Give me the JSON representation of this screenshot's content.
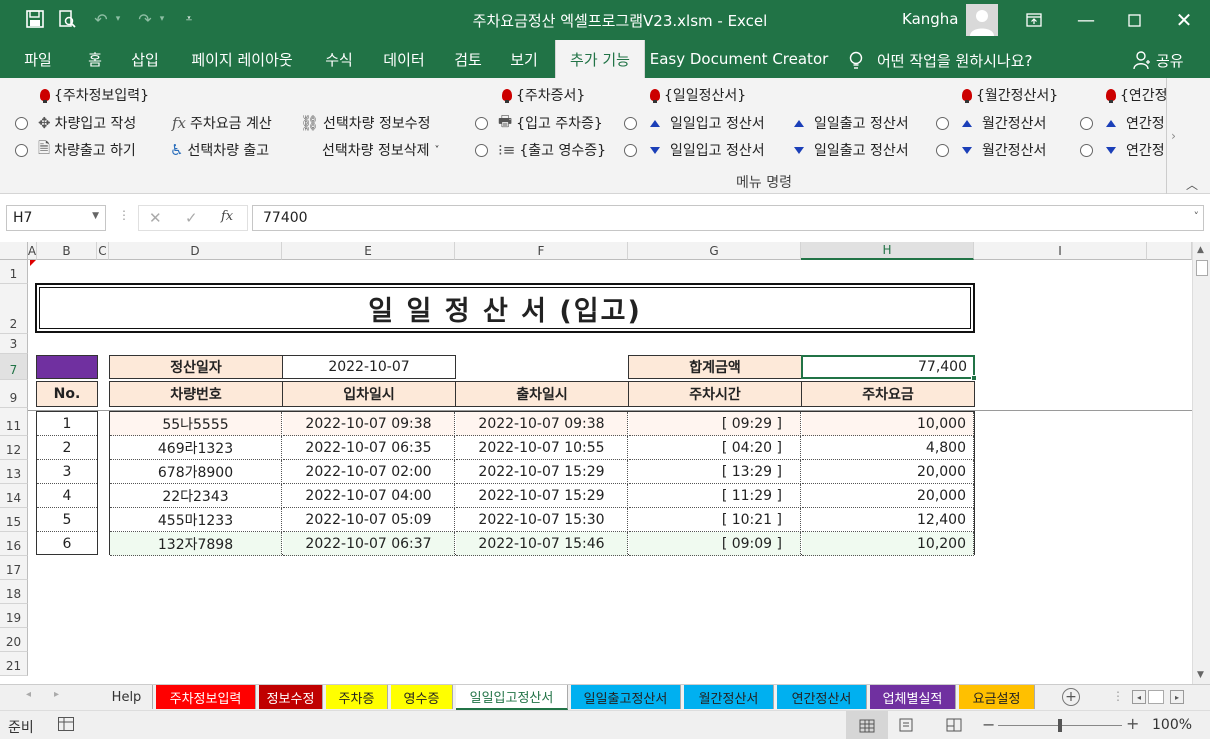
{
  "window": {
    "title": "주차요금정산 엑셀프로그램V23.xlsm  -  Excel",
    "user": "Kangha"
  },
  "ribbon_tabs": [
    "파일",
    "홈",
    "삽입",
    "페이지 레이아웃",
    "수식",
    "데이터",
    "검토",
    "보기",
    "추가 기능",
    "Easy Document Creator"
  ],
  "tell_me": "어떤 작업을 원하시나요?",
  "share": "공유",
  "ribbon": {
    "group1_title": "{주차정보입력}",
    "car_in": "차량입고 작성",
    "car_out": "차량출고 하기",
    "fee_calc": "주차요금 계산",
    "selected_out": "선택차량 출고",
    "selected_edit": "선택차량 정보수정",
    "selected_delete": "선택차량 정보삭제",
    "group2_title": "{주차증서}",
    "in_ticket": "{입고 주차증}",
    "out_receipt": "{출고 영수증}",
    "group3_title": "{일일정산서}",
    "daily_in_1": "일일입고 정산서",
    "daily_in_2": "일일입고 정산서",
    "daily_out_1": "일일출고 정산서",
    "daily_out_2": "일일출고 정산서",
    "group4_title": "{월간정산서}",
    "monthly_1": "월간정산서",
    "monthly_2": "월간정산서",
    "group5_title": "{연간정",
    "yearly_1": "연간정",
    "yearly_2": "연간정",
    "menu_label": "메뉴 명령"
  },
  "formula_bar": {
    "name_box": "H7",
    "value": "77400"
  },
  "columns": [
    "A",
    "B",
    "C",
    "D",
    "E",
    "F",
    "G",
    "H",
    "I"
  ],
  "rows": [
    "1",
    "2",
    "3",
    "7",
    "9",
    "11",
    "12",
    "13",
    "14",
    "15",
    "16",
    "17",
    "18",
    "19",
    "20",
    "21"
  ],
  "sheet": {
    "title": "일 일 정 산 서 (입고)",
    "date_label": "정산일자",
    "date_value": "2022-10-07",
    "total_label": "합계금액",
    "total_value": "77,400",
    "headers": {
      "no": "No.",
      "car": "차량번호",
      "in": "입차일시",
      "out": "출차일시",
      "time": "주차시간",
      "fee": "주차요금"
    },
    "records": [
      {
        "no": "1",
        "car": "55나5555",
        "in": "2022-10-07 09:38",
        "out": "2022-10-07 09:38",
        "time": "[ 09:29 ]",
        "fee": "10,000"
      },
      {
        "no": "2",
        "car": "469라1323",
        "in": "2022-10-07 06:35",
        "out": "2022-10-07 10:55",
        "time": "[ 04:20 ]",
        "fee": "4,800"
      },
      {
        "no": "3",
        "car": "678가8900",
        "in": "2022-10-07 02:00",
        "out": "2022-10-07 15:29",
        "time": "[ 13:29 ]",
        "fee": "20,000"
      },
      {
        "no": "4",
        "car": "22다2343",
        "in": "2022-10-07 04:00",
        "out": "2022-10-07 15:29",
        "time": "[ 11:29 ]",
        "fee": "20,000"
      },
      {
        "no": "5",
        "car": "455마1233",
        "in": "2022-10-07 05:09",
        "out": "2022-10-07 15:30",
        "time": "[ 10:21 ]",
        "fee": "12,400"
      },
      {
        "no": "6",
        "car": "132자7898",
        "in": "2022-10-07 06:37",
        "out": "2022-10-07 15:46",
        "time": "[ 09:09 ]",
        "fee": "10,200"
      }
    ]
  },
  "sheet_tabs": [
    {
      "label": "Help",
      "bg": "#f0f0f0",
      "fg": "#333"
    },
    {
      "label": "주차정보입력",
      "bg": "#ff0000",
      "fg": "#fff"
    },
    {
      "label": "정보수정",
      "bg": "#c00000",
      "fg": "#fff"
    },
    {
      "label": "주차증",
      "bg": "#ffff00",
      "fg": "#222"
    },
    {
      "label": "영수증",
      "bg": "#ffff00",
      "fg": "#222"
    },
    {
      "label": "일일입고정산서",
      "bg": "#ffffff",
      "fg": "#217346"
    },
    {
      "label": "일일출고정산서",
      "bg": "#00b0f0",
      "fg": "#222"
    },
    {
      "label": "월간정산서",
      "bg": "#00b0f0",
      "fg": "#222"
    },
    {
      "label": "연간정산서",
      "bg": "#00b0f0",
      "fg": "#222"
    },
    {
      "label": "업체별실적",
      "bg": "#7030a0",
      "fg": "#fff"
    },
    {
      "label": "요금설정",
      "bg": "#ffc000",
      "fg": "#222"
    }
  ],
  "status": {
    "ready": "준비",
    "zoom": "100%"
  },
  "colors": {
    "accent": "#217346",
    "header_fill": "#fde9d9",
    "marker": "#7030a0"
  }
}
